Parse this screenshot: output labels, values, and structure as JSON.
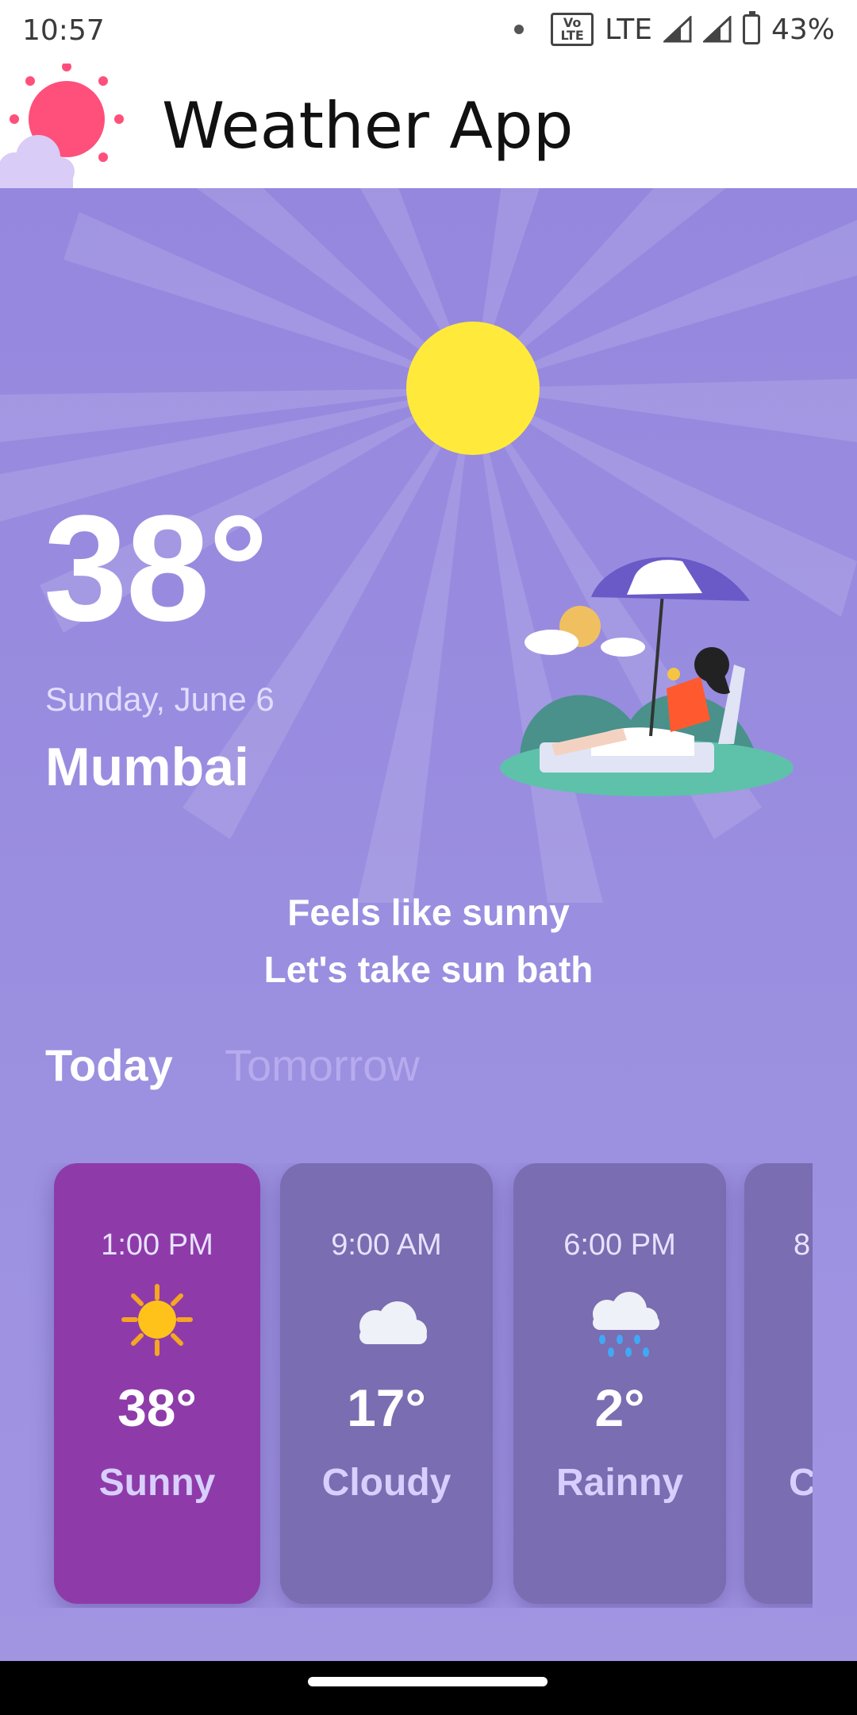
{
  "status_bar": {
    "time": "10:57",
    "network": "LTE",
    "volte": "Vo LTE 2",
    "battery": "43%"
  },
  "app_bar": {
    "title": "Weather App",
    "logo_icon": "sun-cloud-icon"
  },
  "current": {
    "temperature": "38°",
    "date": "Sunday, June 6",
    "city": "Mumbai",
    "illustration": "beach-sunbath-illustration",
    "message_line1": "Feels like sunny",
    "message_line2": "Let's take sun bath"
  },
  "tabs": [
    {
      "label": "Today",
      "active": true
    },
    {
      "label": "Tomorrow",
      "active": false
    }
  ],
  "forecast": [
    {
      "time": "1:00 PM",
      "icon": "sun-icon",
      "temp": "38°",
      "condition": "Sunny",
      "active": true
    },
    {
      "time": "9:00 AM",
      "icon": "cloud-icon",
      "temp": "17°",
      "condition": "Cloudy",
      "active": false
    },
    {
      "time": "6:00 PM",
      "icon": "rain-cloud-icon",
      "temp": "2°",
      "condition": "Rainny",
      "active": false
    },
    {
      "time": "8",
      "icon": "",
      "temp": "",
      "condition": "C",
      "active": false
    }
  ],
  "colors": {
    "background": "#9a8ee0",
    "sun": "#ffea3b",
    "active_card": "#8e3ba9",
    "inactive_card": "#7a6db1",
    "logo_sun": "#ff4f7b"
  }
}
